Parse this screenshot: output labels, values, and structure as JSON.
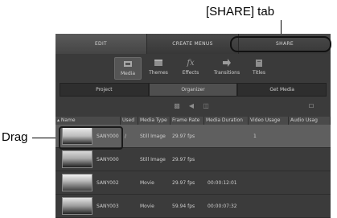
{
  "callouts": {
    "share_tab": "[SHARE] tab",
    "drag": "Drag"
  },
  "top_tabs": {
    "edit": "EDIT",
    "create_menus": "CREATE MENUS",
    "share": "SHARE"
  },
  "toolbar": {
    "media": "Media",
    "themes": "Themes",
    "effects": "Effects",
    "transitions": "Transitions",
    "titles": "Titles"
  },
  "subtabs": {
    "project": "Project",
    "organizer": "Organizer",
    "get_media": "Get Media"
  },
  "columns": {
    "name": "Name",
    "used": "Used",
    "media_type": "Media Type",
    "frame_rate": "Frame Rate",
    "media_duration": "Media Duration",
    "video_usage": "Video Usage",
    "audio_usage": "Audio Usag"
  },
  "rows": [
    {
      "name": "SANY000",
      "used": "/",
      "media_type": "Still Image",
      "frame_rate": "29.97 fps",
      "duration": "",
      "video_usage": "1"
    },
    {
      "name": "SANY000",
      "used": "",
      "media_type": "Still Image",
      "frame_rate": "29.97 fps",
      "duration": "",
      "video_usage": ""
    },
    {
      "name": "SANY002",
      "used": "",
      "media_type": "Movie",
      "frame_rate": "29.97 fps",
      "duration": "00:00:12:01",
      "video_usage": ""
    },
    {
      "name": "SANY003",
      "used": "",
      "media_type": "Movie",
      "frame_rate": "59.94 fps",
      "duration": "00:00:07:32",
      "video_usage": ""
    }
  ],
  "icons": {
    "media": "film-icon",
    "themes": "themes-icon",
    "effects": "fx-icon",
    "transitions": "transition-arrow-icon",
    "titles": "titles-icon"
  }
}
